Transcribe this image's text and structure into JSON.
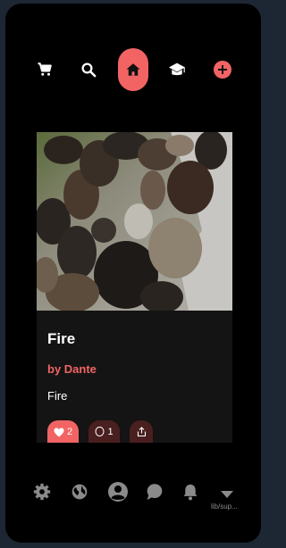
{
  "top_nav": {
    "items": [
      {
        "icon": "cart-icon"
      },
      {
        "icon": "search-icon"
      },
      {
        "icon": "home-icon",
        "active": true
      },
      {
        "icon": "graduation-cap-icon"
      },
      {
        "icon": "add-icon"
      }
    ]
  },
  "post": {
    "title": "Fire",
    "author": "by Dante",
    "description": "Fire",
    "likes": "2",
    "comments": "1"
  },
  "bottom_nav": {
    "items": [
      {
        "icon": "settings-icon"
      },
      {
        "icon": "globe-icon"
      },
      {
        "icon": "profile-icon"
      },
      {
        "icon": "chat-icon"
      },
      {
        "icon": "bell-icon"
      }
    ],
    "more_label": "lib/sup..."
  },
  "colors": {
    "accent": "#f26464",
    "background": "#000000",
    "card": "#141414"
  }
}
